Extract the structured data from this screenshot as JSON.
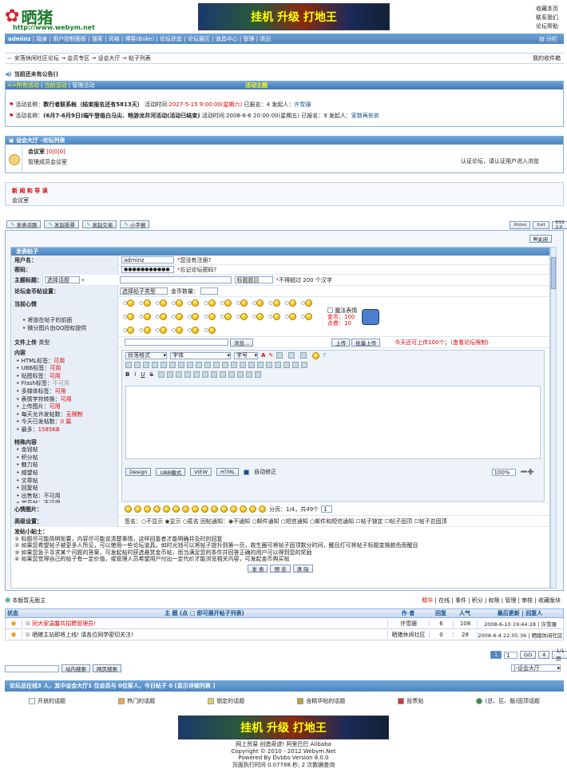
{
  "site": {
    "logo_text": "晒猪",
    "logo_url": "http://www.webym.net",
    "top_links": [
      "收藏本页",
      "联系我们",
      "论坛帮助"
    ],
    "banner_text": "挂机 升级 打地王"
  },
  "nav": {
    "items": [
      "adminz",
      "隐身",
      "用户控制面板",
      "搜索",
      "风格",
      "博客(Boke)",
      "论坛状态",
      "论坛展区",
      "道具中心",
      "管理",
      "退出"
    ],
    "split": "分栏"
  },
  "breadcrumb": {
    "text": "安落休闲社区论坛 → 会员专区 → 设会大厅 → 帖子列表",
    "right": "我的收件箱"
  },
  "notice": {
    "text": "当前还未有公告()"
  },
  "activity": {
    "tabs": [
      "所有活动",
      "当前活动",
      "管理活动"
    ],
    "title": "活动主题",
    "items": [
      {
        "prefix": "活动名称：",
        "name": "数行者联系帐（结束报名还有5813天）",
        "time_label": "活动时间:",
        "time": "2027-5-15 9:00:00(星期六)",
        "signed": "已报名：4",
        "creator_label": "发起人：",
        "creator": "许雪珊"
      },
      {
        "prefix": "活动名称：",
        "name": "(6月7-6月9日)端午登临白马尖、畅游龙井河活动(活动已结束)",
        "time_label": "活动时间:",
        "time": "2008-6-6 20:00:00(星期五)",
        "signed": "已报名：9",
        "creator_label": "发起人：",
        "creator": "家数再依依"
      }
    ]
  },
  "forum_list": {
    "title": "设会大厅 -论坛列表",
    "name": "会议室",
    "stats": "[0|0|0]",
    "desc": "管理成员会议室",
    "right": "认证论坛，请认证用户进入浏览"
  },
  "rules": {
    "title": "新 闻 和 导 读",
    "text": "会议室"
  },
  "tools": {
    "buttons": [
      "发表话题",
      "发起投票",
      "发起交易",
      "小字报"
    ],
    "right": [
      "Xhtml",
      "Xslt",
      "RSS 2.0"
    ]
  },
  "post_form": {
    "close": "关闭",
    "title": "发表帖子",
    "username_label": "用户名：",
    "username": "adminz",
    "username_note": "您没有注册?",
    "password_label": "密码：",
    "password": "●●●●●●●●●●●",
    "password_note": "忘记论坛密码?",
    "subject_label": "主题标题：",
    "subject_select": "选择话题",
    "subject_right": "标题题目",
    "subject_note": "不得超过 200 个汉字",
    "coin_label": "论坛金币帖设置：",
    "coin_select": "选择帖子类型",
    "coin_count": "金币数量：",
    "mood_label": "当前心情",
    "mood_opts": [
      "将放在帖子的前面",
      "微分图片由QQ授权提供"
    ],
    "magic": "魔法表情",
    "coin": "金币：100",
    "points": "点券：10",
    "upload_label": "文件上传",
    "upload_type": "类型",
    "browse": "浏览...",
    "upload": "上传",
    "batch": "批量上传",
    "upload_note": "今天还可上传100个；（查看论坛限制)",
    "content_label": "内容",
    "content_items": [
      [
        "HTML标签：",
        "可用"
      ],
      [
        "UBB标签：",
        "可用"
      ],
      [
        "贴图标签：",
        "可用"
      ],
      [
        "Flash标签：",
        "不可用"
      ],
      [
        "多媒体标签：",
        "可用"
      ],
      [
        "表情字符转换：",
        "可用"
      ],
      [
        "上传图片：",
        "可用"
      ],
      [
        "每天允许发帖数：",
        "无限制"
      ],
      [
        "今天已发帖数：",
        "0 篇"
      ],
      [
        "最多：",
        "1585KB"
      ]
    ],
    "special_label": "特殊内容",
    "special_items": [
      "金钱帖",
      "积分帖",
      "魅力帖",
      "威望帖",
      "文章帖",
      "回复帖",
      "出售帖：不可用",
      "定员帖：不可用"
    ],
    "editor": {
      "format": "段落格式",
      "font": "字体",
      "size": "字号",
      "buttons": [
        "Design",
        "UBB模式",
        "VIEW",
        "HTML"
      ],
      "auto": "自动修正",
      "zoom": "100%"
    },
    "face_label": "心情图片：",
    "face_pages": "分页：1/4，共49个",
    "face_sel": "1",
    "adv_label": "高级设置：",
    "adv_text": "签名：○不显示 ◉显示 ○匿名  回帖通知：◉不通知 ○邮件通知 ○短信通知 ○邮件和短信通知  ☐帖子锁定  ☐帖子固顶  ☐帖子总固顶",
    "tips_title": "发帖小贴士：",
    "tips": [
      "① 标题尽可能简明扼要，内容尽可能说清楚事情，这样回复者才能明确并及时的回复",
      "② 如果您希望帖子被更多人所见，可以使用一些论坛道具。如时光钱可以将帖子提升到第一页，救生圈可将帖子固顶数分时间，醒目灯可将帖子标题变换颜色而醒目",
      "③ 如果您急于寻求某个问题的答案，可发起帖时获选悬赏金币帖，而当满足您的条件并回答正确的用户可以得到您的奖励",
      "④ 如果您觉得自己的帖子有一定价值，或管理人员希望用户付出一定代价才能浏览相关内容，可发起金币购买帖"
    ],
    "submit": [
      "发 表",
      "预 览",
      "清 除"
    ]
  },
  "topic_list": {
    "moderator": "本版暂无版主",
    "links": [
      "精华",
      "在线",
      "事件",
      "积分",
      "权限",
      "管理",
      "审核",
      "收藏版块"
    ],
    "headers": [
      "状态",
      "主 题 (点 □ 即可展开帖子列表)",
      "作 者",
      "回复",
      "人气",
      "最后更新 | 回复人"
    ],
    "rows": [
      {
        "title": "同大家温馨共招聘管理员!",
        "author": "许雪珊",
        "replies": "6",
        "views": "108",
        "last": "2008-6-10 19:44:28 | 许雪珊"
      },
      {
        "title": "晒猪主站即将上线! 请各位网学密切关注!",
        "author": "晒猪休闲社区",
        "replies": "0",
        "views": "28",
        "last": "2008-6-4 22:05:36 | 晒猪休闲社区"
      }
    ],
    "pages": [
      "1",
      "1",
      "GO",
      "4",
      "1/1页"
    ]
  },
  "search": {
    "buttons": [
      "站内搜索",
      "网页搜索"
    ],
    "jump": "|-设会大厅"
  },
  "online": {
    "text": "论坛总在线3 人，其中设会大厅1 位会员与 0位客人，今日帖子 0 [显示详细列表 ]"
  },
  "legend": [
    "开放的话题",
    "热门的话题",
    "锁定的话题",
    "含精华帖的话题",
    "投票贴",
    "(总、区、版)固顶话题"
  ],
  "footer": {
    "line1": "网上贸易 创造奇迹! 阿里巴巴 Alibaba",
    "line2": "Copyright © 2010 - 2012 Webym.Net",
    "line3": "Powered By Dvbbs Version 8.0.0",
    "line4": "页面执行时间 0.07788 秒, 2 次数据查询"
  },
  "colors": {
    "accent": "#124f8c",
    "bar": "#4f86c2",
    "red": "#d00000"
  }
}
